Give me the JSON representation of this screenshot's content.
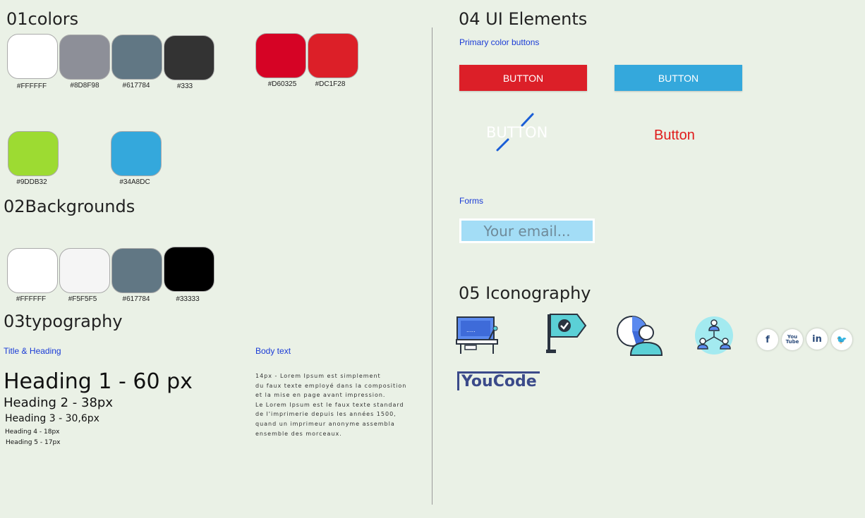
{
  "colors": {
    "title": "01colors",
    "swatches": [
      {
        "hex": "#FFFFFF",
        "label": "#FFFFFF"
      },
      {
        "hex": "#8D8F98",
        "label": "#8D8F98"
      },
      {
        "hex": "#617784",
        "label": "#617784"
      },
      {
        "hex": "#333333",
        "label": "#333"
      },
      {
        "hex": "#D60325",
        "label": "#D60325"
      },
      {
        "hex": "#DC1F28",
        "label": "#DC1F28"
      },
      {
        "hex": "#9DDB32",
        "label": "#9DDB32"
      },
      {
        "hex": "#34A8DC",
        "label": "#34A8DC"
      }
    ]
  },
  "backgrounds": {
    "title": "02Backgrounds",
    "swatches": [
      {
        "hex": "#FFFFFF",
        "label": "#FFFFFF"
      },
      {
        "hex": "#F5F5F5",
        "label": "#F5F5F5"
      },
      {
        "hex": "#617784",
        "label": "#617784"
      },
      {
        "hex": "#000000",
        "label": "#33333"
      }
    ]
  },
  "typography": {
    "title": "03typography",
    "title_heading_label": "Title & Heading",
    "body_text_label": "Body text",
    "headings": [
      "Heading 1 - 60 px",
      "Heading 2 - 38px",
      "Heading 3 - 30,6px",
      "Heading 4 - 18px",
      "Heading 5 - 17px"
    ],
    "body": "14px - Lorem Ipsum est simplement\n du faux texte employé dans la composition\n et la mise en page avant impression.\nLe Lorem Ipsum est le faux texte standard\n de l'imprimerie depuis les années 1500,\n quand un imprimeur anonyme assembla\n ensemble des morceaux."
  },
  "ui_elements": {
    "title": "04 UI Elements",
    "primary_label": "Primary color buttons",
    "button_red": "BUTTON",
    "button_blue": "BUTTON",
    "button_ghost": "BUTTON",
    "button_text": "Button",
    "forms_label": "Forms",
    "email_placeholder": "Your email..."
  },
  "iconography": {
    "title": "05 Iconography",
    "social": [
      "f",
      "You Tube",
      "in",
      "🐦"
    ],
    "logo": "YouCode"
  },
  "palette": {
    "red": "#DC1F28",
    "blue": "#34A8DC",
    "label_blue": "#1A3BD6"
  }
}
